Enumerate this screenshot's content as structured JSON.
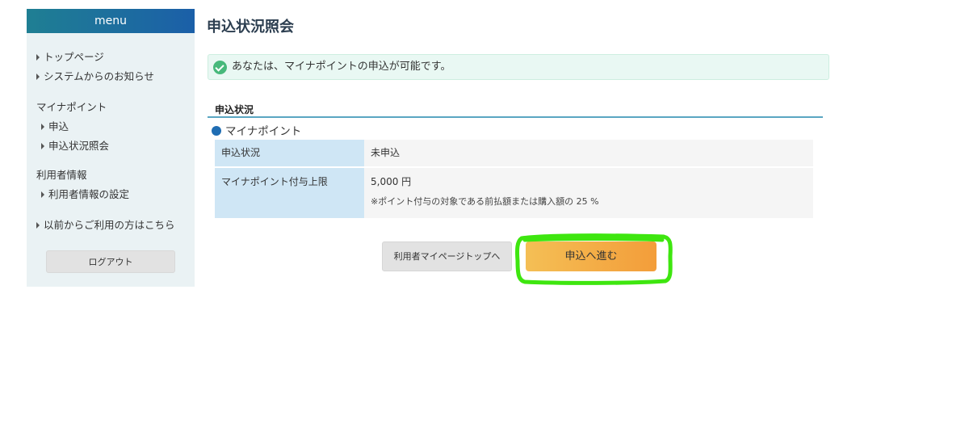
{
  "sidebar": {
    "header": "menu",
    "top_links": [
      {
        "label": "トップページ"
      },
      {
        "label": "システムからのお知らせ"
      }
    ],
    "sections": [
      {
        "heading": "マイナポイント",
        "items": [
          {
            "label": "申込"
          },
          {
            "label": "申込状況照会"
          }
        ]
      },
      {
        "heading": "利用者情報",
        "items": [
          {
            "label": "利用者情報の設定"
          }
        ]
      }
    ],
    "legacy_link": "以前からご利用の方はこちら",
    "logout_label": "ログアウト"
  },
  "main": {
    "page_title": "申込状況照会",
    "notice_text": "あなたは、マイナポイントの申込が可能です。",
    "section_title": "申込状況",
    "subsection_title": "マイナポイント",
    "table": {
      "rows": [
        {
          "label": "申込状況",
          "value": "未申込",
          "note": ""
        },
        {
          "label": "マイナポイント付与上限",
          "value": "5,000 円",
          "note": "※ポイント付与の対象である前払額または購入額の 25 %"
        }
      ]
    },
    "buttons": {
      "mypage_top": "利用者マイページトップへ",
      "proceed": "申込へ進む"
    }
  },
  "colors": {
    "sidebar_header_start": "#1f7f93",
    "sidebar_header_end": "#1b5fa8",
    "sidebar_bg": "#eaf2f4",
    "notice_bg": "#e9f8f3",
    "check_green": "#47b97b",
    "table_header_bg": "#cfe6f5",
    "proceed_start": "#f4bf55",
    "proceed_end": "#f39d3a",
    "highlight_green": "#3ee60f"
  },
  "icons": {
    "notice": "check-circle-icon",
    "bullet": "dot-icon",
    "menu_arrow": "caret-right-icon"
  }
}
